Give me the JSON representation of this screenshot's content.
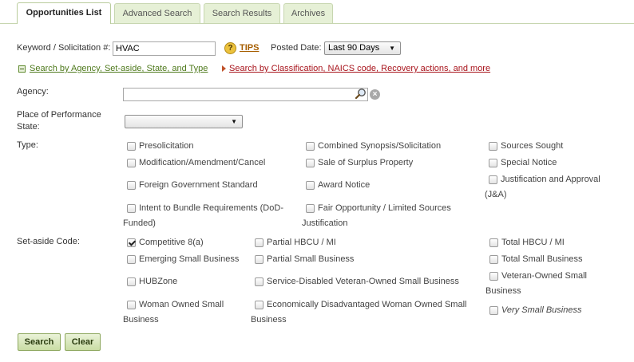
{
  "tabs": [
    {
      "label": "Opportunities List",
      "active": true
    },
    {
      "label": "Advanced Search",
      "active": false
    },
    {
      "label": "Search Results",
      "active": false
    },
    {
      "label": "Archives",
      "active": false
    }
  ],
  "keyword": {
    "label": "Keyword / Solicitation #:",
    "value": "HVAC"
  },
  "help": {
    "icon": "question-icon",
    "glyph": "?",
    "tips_label": "TIPS"
  },
  "posted_date": {
    "label": "Posted Date:",
    "value": "Last 90 Days"
  },
  "expanders": {
    "agency_search": "Search by Agency, Set-aside, State, and Type",
    "classification_search": "Search by Classification, NAICS code, Recovery actions, and more"
  },
  "agency": {
    "label": "Agency:",
    "value": "",
    "clear_glyph": "×"
  },
  "place_of_performance": {
    "label_line1": "Place of Performance",
    "label_line2": "State:",
    "value": ""
  },
  "type": {
    "label": "Type:",
    "options": [
      {
        "label": "Presolicitation",
        "checked": false
      },
      {
        "label": "Combined Synopsis/Solicitation",
        "checked": false
      },
      {
        "label": "Sources Sought",
        "checked": false
      },
      {
        "label": "Modification/Amendment/Cancel",
        "checked": false
      },
      {
        "label": "Sale of Surplus Property",
        "checked": false
      },
      {
        "label": "Special Notice",
        "checked": false
      },
      {
        "label": "Foreign Government Standard",
        "checked": false
      },
      {
        "label": "Award Notice",
        "checked": false
      },
      {
        "label": "Justification and Approval",
        "label2": "(J&A)",
        "checked": false
      },
      {
        "label": "Intent to Bundle Requirements (DoD-",
        "label2": "Funded)",
        "checked": false
      },
      {
        "label": "Fair Opportunity / Limited Sources",
        "label2": "Justification",
        "checked": false
      }
    ]
  },
  "set_aside": {
    "label": "Set-aside Code:",
    "options": [
      {
        "label": "Competitive 8(a)",
        "checked": true
      },
      {
        "label": "Partial HBCU / MI",
        "checked": false
      },
      {
        "label": "Total HBCU / MI",
        "checked": false
      },
      {
        "label": "Emerging Small Business",
        "checked": false
      },
      {
        "label": "Partial Small Business",
        "checked": false
      },
      {
        "label": "Total Small Business",
        "checked": false
      },
      {
        "label": "HUBZone",
        "checked": false
      },
      {
        "label": "Service-Disabled Veteran-Owned Small Business",
        "checked": false
      },
      {
        "label": "Veteran-Owned Small",
        "label2": "Business",
        "checked": false
      },
      {
        "label": "Woman Owned Small",
        "label2": "Business",
        "checked": false
      },
      {
        "label": "Economically Disadvantaged Woman Owned Small",
        "label2": "Business",
        "checked": false
      },
      {
        "label": "Very Small Business",
        "checked": false
      }
    ]
  },
  "buttons": {
    "search": "Search",
    "clear": "Clear"
  },
  "colors": {
    "tab_bg": "#e6f0d6",
    "link_green": "#4f7a1d",
    "link_red": "#a8141c",
    "button_bg": "#c9dca4"
  }
}
